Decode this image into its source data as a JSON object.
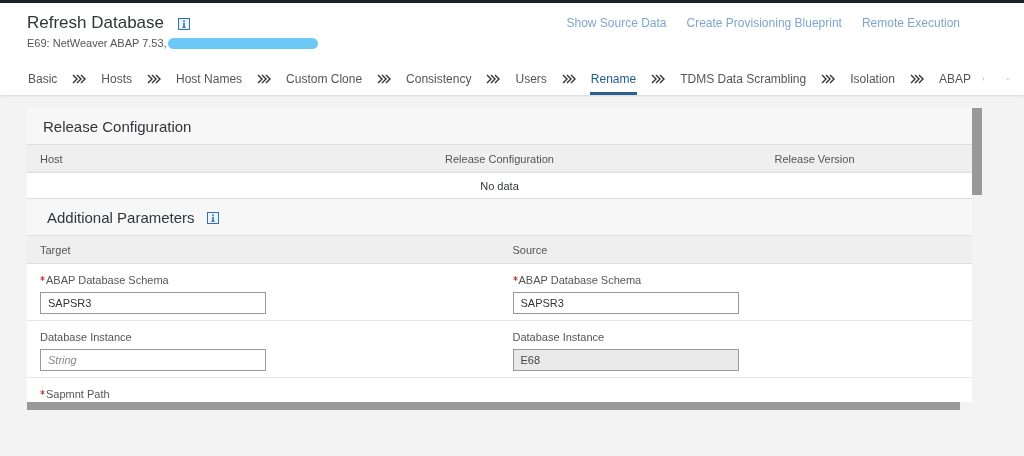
{
  "header": {
    "title": "Refresh Database",
    "subtitle": "E69: NetWeaver ABAP 7.53,",
    "actions": [
      "Show Source Data",
      "Create Provisioning Blueprint",
      "Remote Execution"
    ]
  },
  "tabs": [
    {
      "label": "Basic",
      "selected": false
    },
    {
      "label": "Hosts",
      "selected": false
    },
    {
      "label": "Host Names",
      "selected": false
    },
    {
      "label": "Custom Clone",
      "selected": false
    },
    {
      "label": "Consistency",
      "selected": false
    },
    {
      "label": "Users",
      "selected": false
    },
    {
      "label": "Rename",
      "selected": true
    },
    {
      "label": "TDMS Data Scrambling",
      "selected": false
    },
    {
      "label": "Isolation",
      "selected": false
    },
    {
      "label": "ABAP",
      "selected": false
    }
  ],
  "release_configuration": {
    "title": "Release Configuration",
    "columns": [
      "Host",
      "Release Configuration",
      "Release Version"
    ],
    "empty_text": "No data"
  },
  "additional_parameters": {
    "title": "Additional Parameters",
    "columns": [
      "Target",
      "Source"
    ],
    "rows": [
      [
        {
          "label": "ABAP Database Schema",
          "required": true,
          "value": "SAPSR3",
          "readonly": false
        },
        {
          "label": "ABAP Database Schema",
          "required": true,
          "value": "SAPSR3",
          "readonly": false
        }
      ],
      [
        {
          "label": "Database Instance",
          "required": false,
          "placeholder": "String",
          "readonly": false
        },
        {
          "label": "Database Instance",
          "required": false,
          "value": "E68",
          "readonly": true
        }
      ],
      [
        {
          "label": "Sapmnt Path",
          "required": true
        }
      ]
    ]
  }
}
